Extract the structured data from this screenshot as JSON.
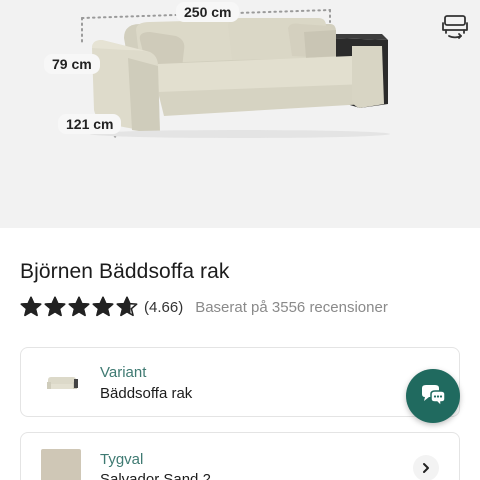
{
  "dimensions": {
    "width": "250 cm",
    "height": "79 cm",
    "depth": "121 cm"
  },
  "product": {
    "title": "Björnen Bäddsoffa rak",
    "rating_score": "(4.66)",
    "rating_value": 4.66,
    "rating_max": 5,
    "reviews_text": "Baserat på 3556 recensioner"
  },
  "options": {
    "variant": {
      "label": "Variant",
      "value": "Bäddsoffa rak"
    },
    "fabric": {
      "label": "Tygval",
      "value": "Salvador Sand 2"
    }
  },
  "icons": {
    "ar": "sofa-rotate-icon",
    "star": "star-icon",
    "chevron": "chevron-right-icon",
    "chat": "chat-bubbles-icon"
  },
  "colors": {
    "accent": "#206a5f",
    "label_text": "#3f7a72",
    "sofa_fabric": "#d9d6c6",
    "hero_bg": "#f2f2f2"
  }
}
